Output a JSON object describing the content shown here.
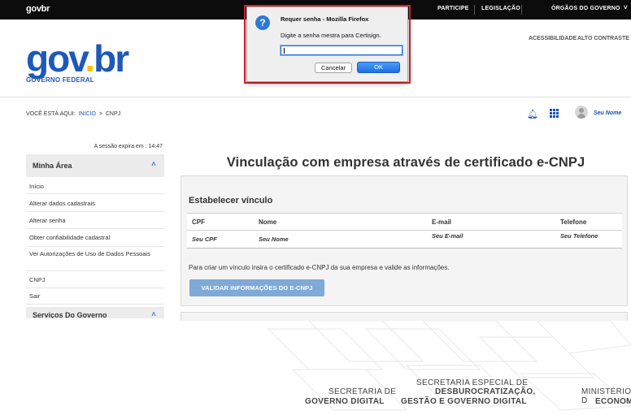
{
  "topbar": {
    "logo": "govbr",
    "links": [
      "PARTICIPE",
      "LEGISLAÇÃO",
      "ÓRGÃOS DO GOVERNO"
    ]
  },
  "header": {
    "accessibility": "ACESSIBILIDADE",
    "contrast": "ALTO CONTRASTE",
    "brand_g": "gov",
    "brand_dot": ".",
    "brand_br": "br",
    "brand_sub": "GOVERNO FEDERAL"
  },
  "breadcrumb": {
    "prefix": "VOCÊ ESTÁ AQUI:",
    "home": "INICIO",
    "separator": ">",
    "current": "CNPJ"
  },
  "user": {
    "name": "Seu Nome"
  },
  "sidebar": {
    "session": "A sessão expira em : 14:47",
    "section_title": "Minha Área",
    "items": [
      {
        "label": "Início"
      },
      {
        "label": "Alterar dados cadastrais"
      },
      {
        "label": "Alterar senha"
      },
      {
        "label": "Obter confiabilidade cadastral"
      },
      {
        "label": "Ver Autorizações de Uso de Dados Pessoais"
      },
      {
        "label": "CNPJ"
      },
      {
        "label": "Sair"
      }
    ],
    "section2_title": "Serviços Do Governo"
  },
  "main": {
    "title": "Vinculação com empresa através de certificado e-CNPJ",
    "panel_title": "Estabelecer vínculo",
    "table": {
      "headers": [
        "CPF",
        "Nome",
        "E-mail",
        "Telefone"
      ],
      "row": [
        "Seu CPF",
        "Seu Nome",
        "Seu E-mail",
        "Seu Telefone"
      ]
    },
    "info": "Para criar um vínculo insira o certificado e-CNPJ da sua empresa e valide as informações.",
    "validate_button": "VALIDAR INFORMAÇÕES DO E-CNPJ"
  },
  "footer": {
    "sec1_line1": "SECRETARIA DE",
    "sec1_line2": "GOVERNO DIGITAL",
    "sec2_line0": "SECRETARIA ESPECIAL DE",
    "sec2_line1": "DESBUROCRATIZAÇÃO,",
    "sec2_line2": "GESTÃO E GOVERNO DIGITAL",
    "sec3_line1": "MINISTÉRIO D",
    "sec3_line2": "ECONOM"
  },
  "dialog": {
    "title": "Requer senha - Mozilla Firefox",
    "message": "Digite a senha mestra para Certisign.",
    "password_value": "",
    "cancel": "Cancelar",
    "ok": "OK",
    "icon": "question-icon"
  },
  "colors": {
    "brand_blue": "#1351b4",
    "highlight_red": "#e0222b",
    "button_disabled": "#7fa9d6"
  }
}
